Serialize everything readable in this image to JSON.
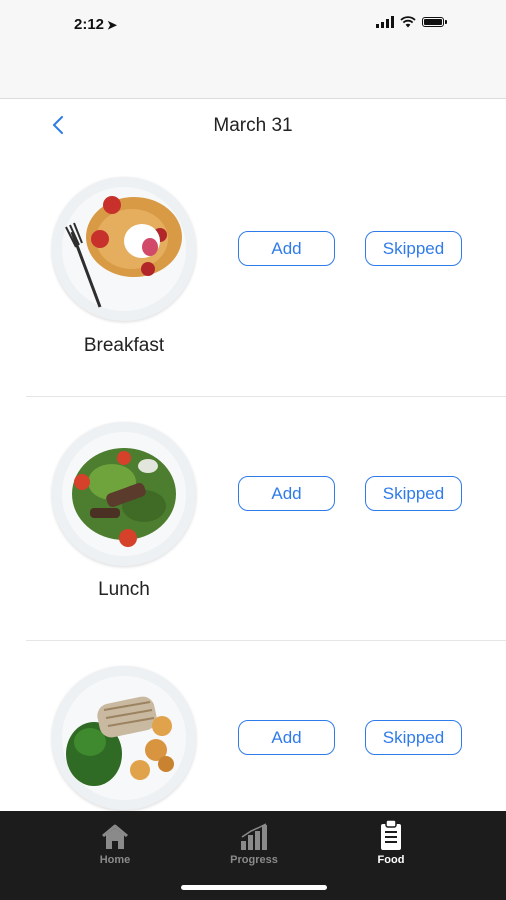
{
  "status_bar": {
    "time": "2:12",
    "location_icon": "location-arrow-icon",
    "signal_icon": "cellular-signal-icon",
    "wifi_icon": "wifi-icon",
    "battery_icon": "battery-icon"
  },
  "header": {
    "title": "March 31",
    "back_icon": "chevron-left-icon"
  },
  "meals": [
    {
      "label": "Breakfast",
      "image": "pancakes-plate",
      "add_label": "Add",
      "skip_label": "Skipped"
    },
    {
      "label": "Lunch",
      "image": "salad-plate",
      "add_label": "Add",
      "skip_label": "Skipped"
    },
    {
      "label": "",
      "image": "chicken-shrimp-broccoli-plate",
      "add_label": "Add",
      "skip_label": "Skipped"
    }
  ],
  "tabs": [
    {
      "label": "Home",
      "icon": "home-icon",
      "active": false
    },
    {
      "label": "Progress",
      "icon": "bar-chart-icon",
      "active": false
    },
    {
      "label": "Food",
      "icon": "clipboard-icon",
      "active": true
    }
  ],
  "colors": {
    "accent": "#2f7bea",
    "tab_bar": "#1c1c1c",
    "tab_active": "#ffffff",
    "tab_inactive": "#8a8a8a"
  }
}
